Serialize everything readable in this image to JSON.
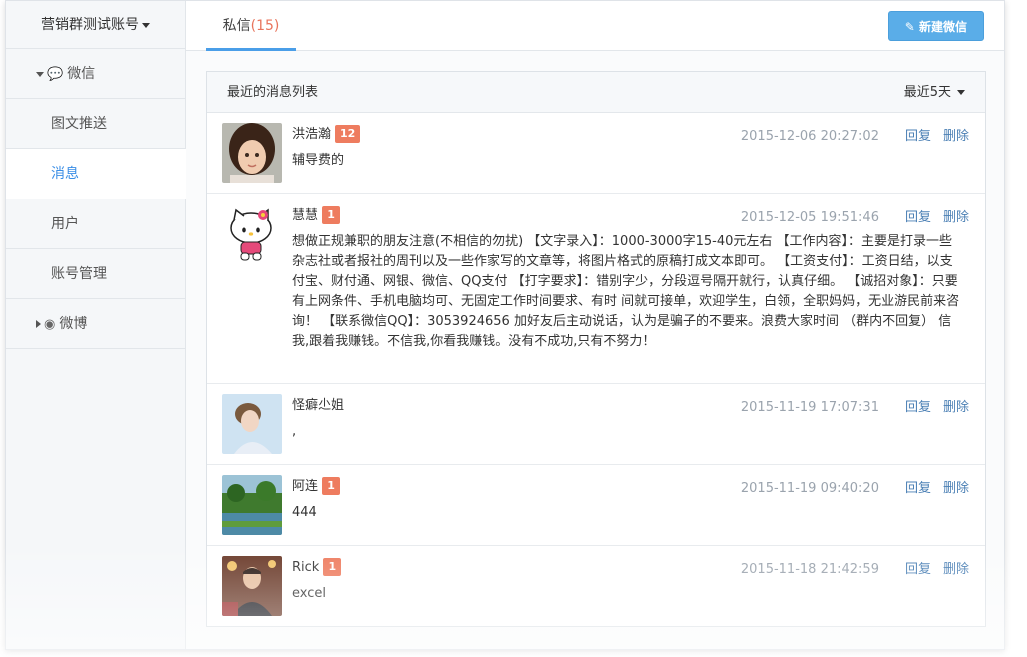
{
  "sidebar": {
    "account": "营销群测试账号",
    "wechat_group": "微信",
    "items": [
      {
        "label": "图文推送"
      },
      {
        "label": "消息"
      },
      {
        "label": "用户"
      },
      {
        "label": "账号管理"
      }
    ],
    "weibo_group": "微博"
  },
  "header": {
    "tab_label": "私信",
    "tab_count": "(15)",
    "new_button": "新建微信"
  },
  "panel": {
    "title": "最近的消息列表",
    "filter": "最近5天"
  },
  "actions": {
    "reply": "回复",
    "delete": "删除"
  },
  "messages": [
    {
      "name": "洪浩瀚",
      "badge": "12",
      "time": "2015-12-06 20:27:02",
      "text": "辅导费的"
    },
    {
      "name": "慧慧",
      "badge": "1",
      "time": "2015-12-05 19:51:46",
      "text": "想做正规兼职的朋友注意(不相信的勿扰) 【文字录入】：1000-3000字15-40元左右 【工作内容】：主要是打录一些杂志社或者报社的周刊以及一些作家写的文章等，将图片格式的原稿打成文本即可。 【工资支付】：工资日结，以支付宝、财付通、网银、微信、QQ支付 【打字要求】：错别字少，分段逗号隔开就行，认真仔细。 【诚招对象】：只要有上网条件、手机电脑均可、无固定工作时间要求、有时 间就可接单，欢迎学生，白领，全职妈妈，无业游民前来咨询！ 【联系微信QQ】：3053924656 加好友后主动说话，认为是骗子的不要来。浪费大家时间 （群内不回复） 信我,跟着我赚钱。不信我,你看我赚钱。没有不成功,只有不努力！"
    },
    {
      "name": "怪癖尐姐",
      "badge": "",
      "time": "2015-11-19 17:07:31",
      "text": ","
    },
    {
      "name": "阿连",
      "badge": "1",
      "time": "2015-11-19 09:40:20",
      "text": "444"
    },
    {
      "name": "Rick",
      "badge": "1",
      "time": "2015-11-18 21:42:59",
      "text": "excel"
    }
  ]
}
